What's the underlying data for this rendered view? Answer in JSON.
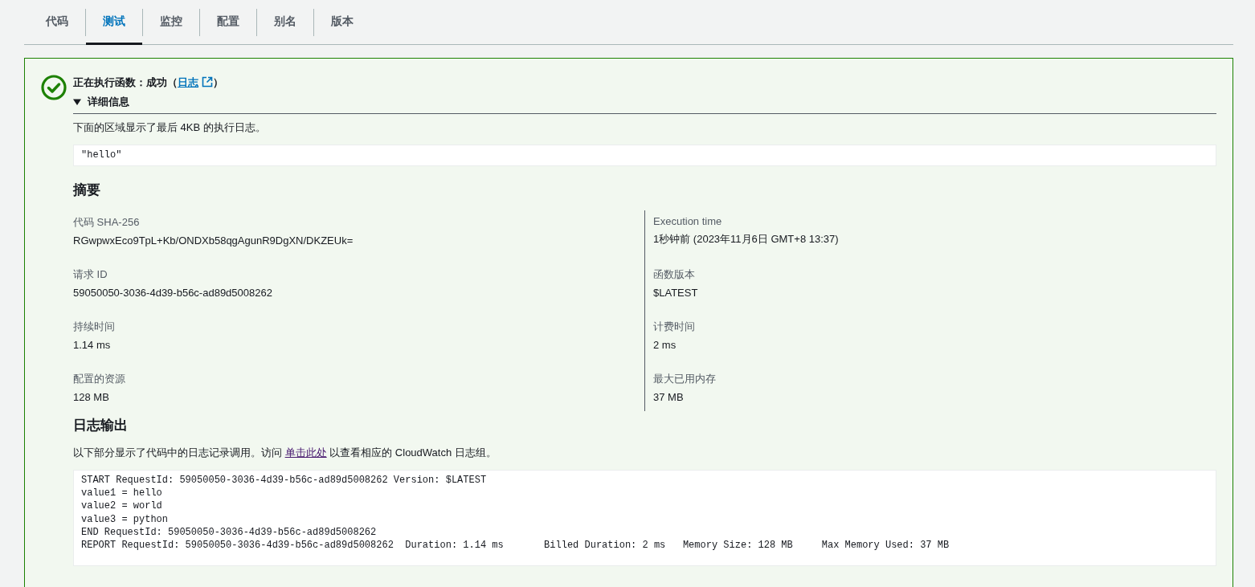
{
  "tabs": [
    {
      "label": "代码",
      "selected": false
    },
    {
      "label": "测试",
      "selected": true
    },
    {
      "label": "监控",
      "selected": false
    },
    {
      "label": "配置",
      "selected": false
    },
    {
      "label": "别名",
      "selected": false
    },
    {
      "label": "版本",
      "selected": false
    }
  ],
  "result": {
    "success": true,
    "title": "正在执行函数：成功（",
    "link": "日志",
    "title_end": "）",
    "details": {
      "label": "详细信息",
      "expanded": true,
      "note": "下面的区域显示了最后 4KB 的执行日志。",
      "output": "\"hello\""
    }
  },
  "summary": {
    "heading": "摘要",
    "left": [
      {
        "label": "代码 SHA-256",
        "value": "RGwpwxEco9TpL+Kb/ONDXb58qgAgunR9DgXN/DKZEUk="
      },
      {
        "label": "请求 ID",
        "value": "59050050-3036-4d39-b56c-ad89d5008262"
      },
      {
        "label": "持续时间",
        "value": "1.14 ms"
      },
      {
        "label": "配置的资源",
        "value": "128 MB"
      }
    ],
    "right": [
      {
        "label": "Execution time",
        "value": "1秒钟前 (2023年11月6日 GMT+8 13:37)"
      },
      {
        "label": "函数版本",
        "value": "$LATEST"
      },
      {
        "label": "计费时间",
        "value": "2 ms"
      },
      {
        "label": "最大已用内存",
        "value": "37 MB"
      }
    ]
  },
  "log_output": {
    "heading": "日志输出",
    "note_before": "以下部分显示了代码中的日志记录调用。访问",
    "link": "单击此处",
    "note_after": "以查看相应的 CloudWatch 日志组。",
    "lines": [
      "START RequestId: 59050050-3036-4d39-b56c-ad89d5008262 Version: $LATEST",
      "value1 = hello",
      "value2 = world",
      "value3 = python",
      "END RequestId: 59050050-3036-4d39-b56c-ad89d5008262",
      "REPORT RequestId: 59050050-3036-4d39-b56c-ad89d5008262  Duration: 1.14 ms       Billed Duration: 2 ms   Memory Size: 128 MB     Max Memory Used: 37 MB"
    ]
  }
}
